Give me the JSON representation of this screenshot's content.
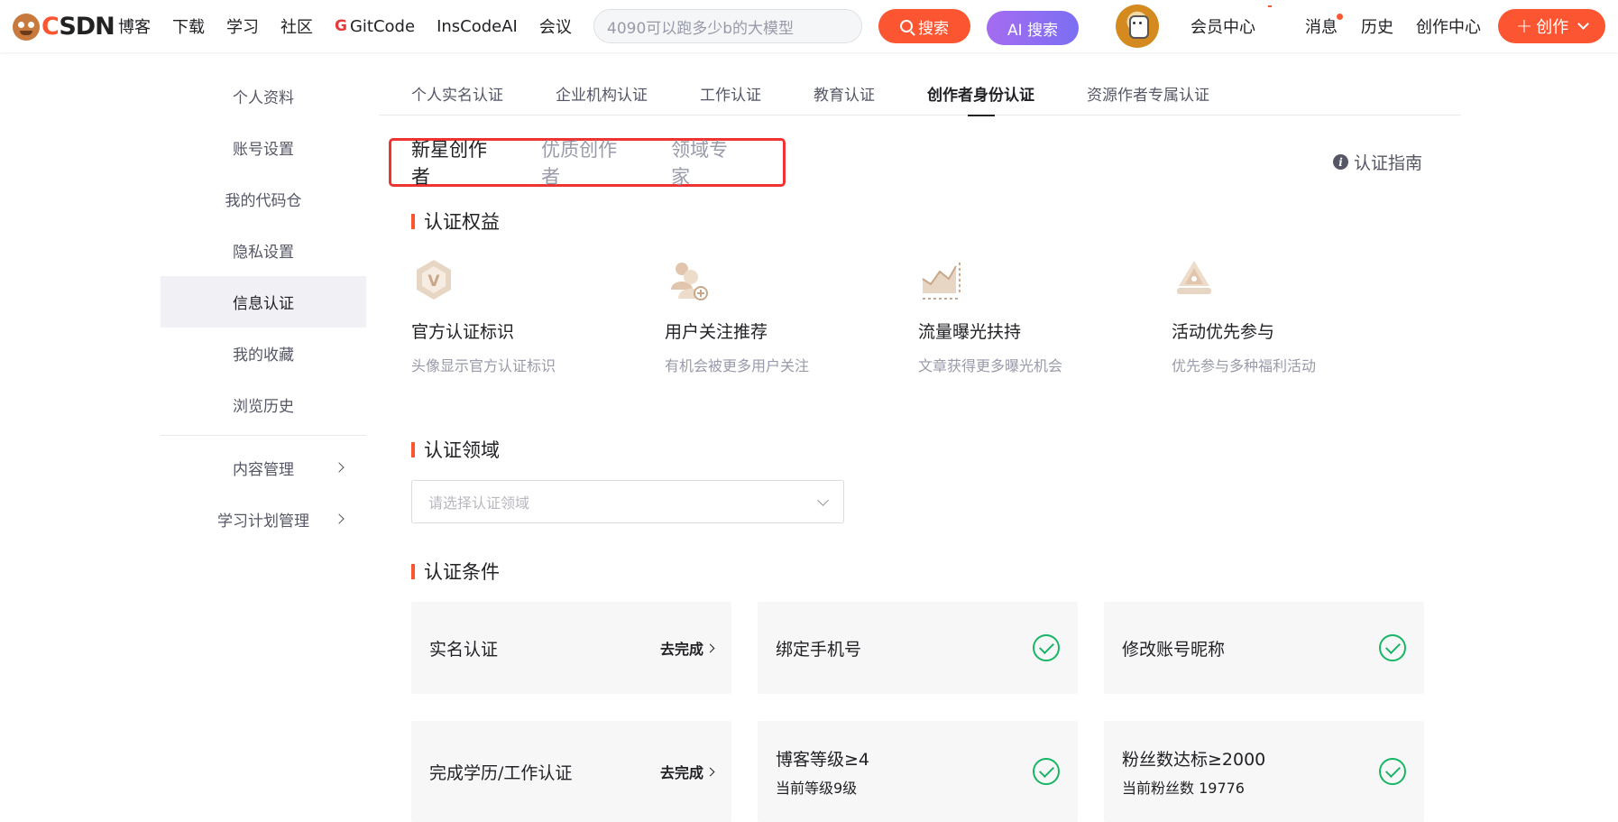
{
  "header": {
    "logo_text_c": "C",
    "logo_text_rest": "SDN",
    "nav": [
      "博客",
      "下载",
      "学习",
      "社区"
    ],
    "gitcode": "GitCode",
    "nav2": [
      "InsCodeAI",
      "会议"
    ],
    "search_placeholder": "4090可以跑多少b的大模型",
    "search_btn": "搜索",
    "ai_btn": "AI 搜索",
    "vip": "会员中心",
    "messages": "消息",
    "history": "历史",
    "creator_center": "创作中心",
    "create_btn": "创作"
  },
  "sidebar": {
    "items": [
      "个人资料",
      "账号设置",
      "我的代码仓",
      "隐私设置",
      "信息认证",
      "我的收藏",
      "浏览历史"
    ],
    "active_index": 4,
    "groups": [
      "内容管理",
      "学习计划管理"
    ]
  },
  "tabs": [
    "个人实名认证",
    "企业机构认证",
    "工作认证",
    "教育认证",
    "创作者身份认证",
    "资源作者专属认证"
  ],
  "active_tab": 4,
  "subtabs": [
    "新星创作者",
    "优质创作者",
    "领域专家"
  ],
  "active_subtab": 0,
  "guide": "认证指南",
  "benefits_title": "认证权益",
  "benefits": [
    {
      "icon": "verified-badge-icon",
      "title": "官方认证标识",
      "desc": "头像显示官方认证标识"
    },
    {
      "icon": "user-follow-icon",
      "title": "用户关注推荐",
      "desc": "有机会被更多用户关注"
    },
    {
      "icon": "traffic-chart-icon",
      "title": "流量曝光扶持",
      "desc": "文章获得更多曝光机会"
    },
    {
      "icon": "activity-priority-icon",
      "title": "活动优先参与",
      "desc": "优先参与多种福利活动"
    }
  ],
  "domain_title": "认证领域",
  "domain_placeholder": "请选择认证领域",
  "conditions_title": "认证条件",
  "conditions": [
    {
      "title": "实名认证",
      "sub": "",
      "status": "todo",
      "action": "去完成"
    },
    {
      "title": "绑定手机号",
      "sub": "",
      "status": "done",
      "action": ""
    },
    {
      "title": "修改账号昵称",
      "sub": "",
      "status": "done",
      "action": ""
    },
    {
      "title": "完成学历/工作认证",
      "sub": "",
      "status": "todo",
      "action": "去完成"
    },
    {
      "title": "博客等级≥4",
      "sub": "当前等级9级",
      "status": "done",
      "action": ""
    },
    {
      "title": "粉丝数达标≥2000",
      "sub": "当前粉丝数 19776",
      "status": "done",
      "action": ""
    }
  ],
  "colors": {
    "brand": "#fc5531",
    "check": "#18b566",
    "highlight_border": "#e33333"
  }
}
